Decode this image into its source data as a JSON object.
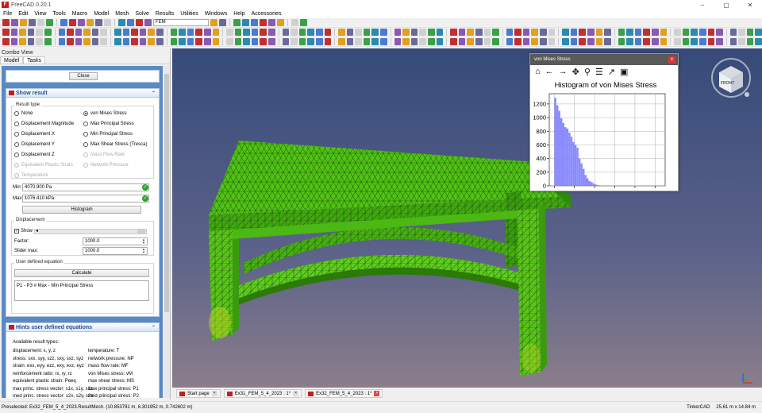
{
  "window": {
    "title": "FreeCAD 0.20.1",
    "controls": [
      "–",
      "▢",
      "✕"
    ]
  },
  "menu": [
    "File",
    "Edit",
    "View",
    "Tools",
    "Macro",
    "Model",
    "Mesh",
    "Solve",
    "Results",
    "Utilities",
    "Windows",
    "Help",
    "Accessories"
  ],
  "toolbar": {
    "workbench": "FEM"
  },
  "combo_view": {
    "title": "Combo View",
    "tabs": [
      "Model",
      "Tasks"
    ]
  },
  "show_result": {
    "close_label": "Close",
    "header": "Show result",
    "result_type_label": "Result type",
    "options_left": [
      "None",
      "Displacement Magnitude",
      "Displacement X",
      "Displacement Y",
      "Displacement Z",
      "Equivalent Plastic Strain",
      "Temperature"
    ],
    "options_right": [
      "von Mises Stress",
      "Max Principal Stress",
      "Min Principal Stress",
      "Max Shear Stress (Tresca)",
      "Mass Flow Rate",
      "Network Pressure"
    ],
    "selected": "von Mises Stress",
    "min_label": "Min:",
    "min_value": "4070.900 Pa",
    "max_label": "Max:",
    "max_value": "1076.410 kPa",
    "histogram_label": "Histogram",
    "displacement_label": "Displacement",
    "show_label": "Show",
    "factor_label": "Factor:",
    "factor_value": "1000.0",
    "slider_max_label": "Slider max:",
    "slider_max_value": "1000.0",
    "user_eq_label": "User defined equation",
    "calculate_label": "Calculate",
    "equation": "P1 - P3 # Max - Min Principal Stress"
  },
  "hints": {
    "header": "Hints user defined equations",
    "title": "Available result types:",
    "left": [
      "displacement: x, y, z",
      "stress: sxx, syy, szz, sxy, sxz, syz",
      "strain: exx, eyy, ezz, exy, exz, eyz",
      "reinforcement ratio: rx, ry, rz",
      "equivalent plastic strain: Peeq",
      "max princ. stress vector: s1x, s1y, s1z",
      "med princ. stress vector: s2x, s2y, s2z"
    ],
    "right": [
      "temperature: T",
      "network pressure: NP",
      "mass flow rate: MF",
      "von Mises stress: vM",
      "max shear stress: MS",
      "max principal stress: P1",
      "med principal stress: P2"
    ]
  },
  "doc_tabs": [
    "Start page",
    "Ex31_FEM_5_4_2023 : 1*",
    "Ex32_FEM_5_4_2023 : 1*"
  ],
  "statusbar": {
    "preselected": "Preselected: Ex32_FEM_5_4_2023.ResultMesh. (10.853781 m, 6.301952 m, 0.742602 m)",
    "nav": "TinkerCAD",
    "dimensions": "25.61 m x 14.84 m"
  },
  "histogram_window": {
    "title": "von Mises Stress",
    "close": "x"
  },
  "navcube": {
    "face": "FRONT"
  },
  "colors": {
    "mesh": "#4fc414",
    "mesh_edge": "#1c3a0a",
    "bar": "#8080ff",
    "accent": "#c41e1e"
  },
  "chart_data": {
    "type": "bar",
    "title": "Histogram of von Mises Stress",
    "x": [
      0.01,
      0.03,
      0.05,
      0.07,
      0.09,
      0.11,
      0.13,
      0.15,
      0.17,
      0.19,
      0.21,
      0.23,
      0.25,
      0.27,
      0.29,
      0.31,
      0.33,
      0.35,
      0.37,
      0.39,
      0.41,
      0.43,
      0.45,
      0.47,
      0.49,
      0.51,
      0.53,
      0.55
    ],
    "values": [
      1290,
      1180,
      1100,
      990,
      920,
      860,
      840,
      780,
      720,
      640,
      600,
      560,
      400,
      330,
      250,
      160,
      110,
      70,
      55,
      35,
      20,
      12,
      8,
      6,
      4,
      3,
      2,
      1
    ],
    "bin_width": 0.02,
    "xlim": [
      -0.05,
      1.1
    ],
    "ylim": [
      0,
      1350
    ],
    "xticks": [
      "0.0",
      "0.2",
      "0.4",
      "0.6",
      "0.8",
      "1.0"
    ],
    "yticks": [
      "0",
      "200",
      "400",
      "600",
      "800",
      "1000",
      "1200"
    ],
    "grid": true
  }
}
